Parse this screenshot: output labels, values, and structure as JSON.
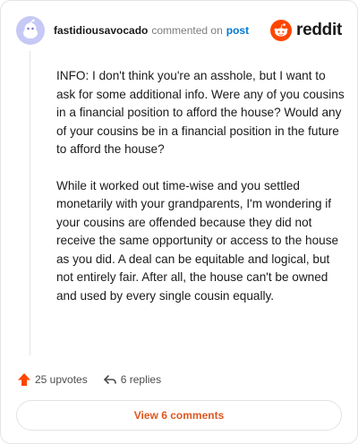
{
  "comment": {
    "username": "fastidiousavocado",
    "action_text": "commented on",
    "target_text": "post",
    "paragraphs": [
      "INFO: I don't think you're an asshole, but I want to ask for some additional info. Were any of you cousins in a financial position to afford the house? Would any of your cousins be in a financial position in the future to afford the house?",
      "While it worked out time-wise and you settled monetarily with your grandparents, I'm wondering if your cousins are offended because they did not receive the same opportunity or access to the house as you did. A deal can be equitable and logical, but not entirely fair. After all, the house can't be owned and used by every single cousin equally."
    ],
    "upvotes_label": "25 upvotes",
    "replies_label": "6 replies"
  },
  "brand": {
    "wordmark": "reddit",
    "color": "#ff4500"
  },
  "view_comments_label": "View 6 comments",
  "icons": {
    "avatar": "snoo-avatar-icon",
    "brand": "reddit-logo-icon",
    "upvote": "upvote-arrow-icon",
    "reply": "reply-arrow-icon"
  },
  "colors": {
    "accent": "#ff4500",
    "link": "#0079d3",
    "button_text": "#e0561f",
    "avatar_bg": "#c6c9f5"
  }
}
